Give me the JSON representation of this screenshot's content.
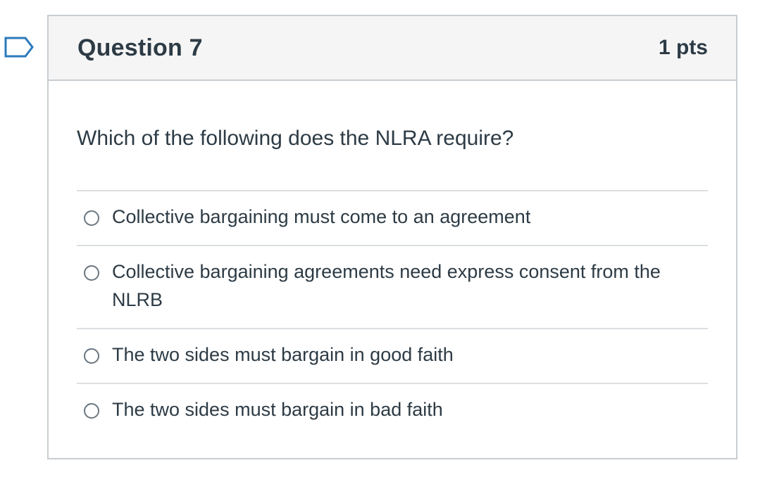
{
  "question": {
    "title": "Question 7",
    "points": "1 pts",
    "text": "Which of the following does the NLRA require?",
    "answers": [
      {
        "label": "Collective bargaining must come to an agreement",
        "selected": false
      },
      {
        "label": "Collective bargaining agreements need express consent from the NLRB",
        "selected": false
      },
      {
        "label": "The two sides must bargain in good faith",
        "selected": false
      },
      {
        "label": "The two sides must bargain in bad faith",
        "selected": false
      }
    ]
  },
  "icons": {
    "flag": "flag-question-icon"
  },
  "colors": {
    "text": "#2d3b45",
    "header_bg": "#f5f5f5",
    "border": "#c7cdd1",
    "flag_stroke": "#2b7abc"
  }
}
